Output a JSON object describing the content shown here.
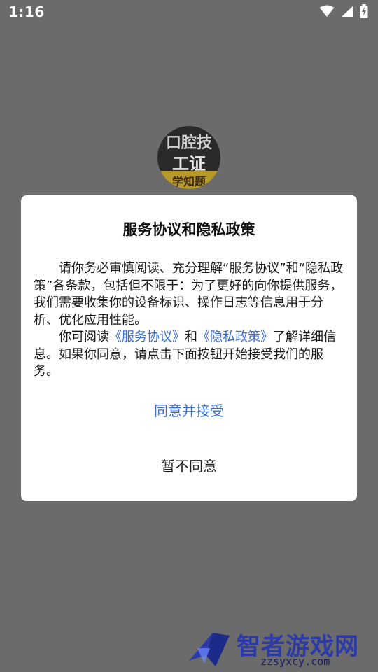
{
  "status_bar": {
    "time": "1:16",
    "icons": [
      "wifi-icon",
      "signal-icon",
      "battery-charging-icon"
    ]
  },
  "app_logo": {
    "line1": "口腔技",
    "line2": "工证",
    "line3": "学知题"
  },
  "dialog": {
    "title": "服务协议和隐私政策",
    "paragraph1": "请你务必审慎阅读、充分理解“服务协议”和“隐私政策”各条款，包括但不限于：为了更好的向你提供服务，我们需要收集你的设备标识、操作日志等信息用于分析、优化应用性能。",
    "p2_prefix": "你可阅读",
    "link_service": "《服务协议》",
    "p2_and": "和",
    "link_privacy": "《隐私政策》",
    "p2_suffix": "了解详细信息。如果你同意，请点击下面按钮开始接受我们的服务。",
    "accept_label": "同意并接受",
    "decline_label": "暂不同意"
  },
  "watermark": {
    "title": "智者游戏网",
    "url": "zzsyxcy.com"
  },
  "colors": {
    "backdrop": "#6b6b6b",
    "link": "#3a6fd8",
    "watermark": "#2b3aa8"
  }
}
